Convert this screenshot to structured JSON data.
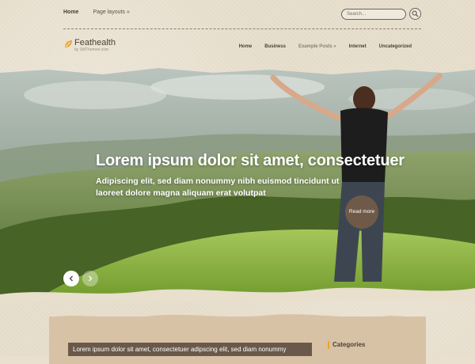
{
  "topnav": {
    "items": [
      "Home",
      "Page layouts »"
    ]
  },
  "search": {
    "placeholder": "Search..."
  },
  "logo": {
    "title": "Feathealth",
    "subtitle": "by SMThemes.com"
  },
  "mainnav": {
    "items": [
      "Home",
      "Business",
      "Example Posts »",
      "Internet",
      "Uncategorized"
    ]
  },
  "hero": {
    "title": "Lorem ipsum dolor sit amet, consectetuer",
    "text": "Adipiscing elit, sed diam nonummy nibh euismod tincidunt ut laoreet dolore magna aliquam erat volutpat",
    "button": "Read more"
  },
  "post": {
    "title": "Lorem ipsum dolor sit amet, consectetuer adipscing elit, sed diam nonummy"
  },
  "sidebar": {
    "heading": "Categories"
  },
  "colors": {
    "background": "#e8dfcd",
    "accent": "#e6a62a",
    "button": "#6f5a49",
    "post_title_bg": "#6a594a"
  }
}
